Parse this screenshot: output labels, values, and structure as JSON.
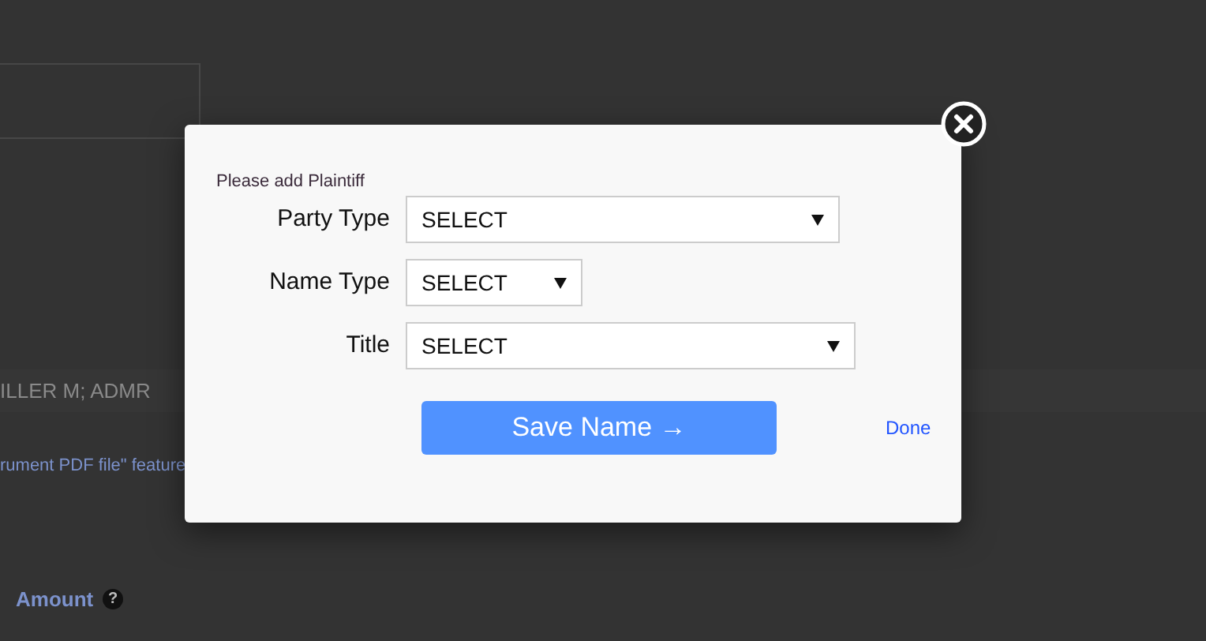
{
  "background": {
    "row_text": "ILLER M; ADMR",
    "link_text": "rument PDF file\" feature",
    "column_header": "Amount",
    "help_icon": "?"
  },
  "dialog": {
    "heading": "Please add Plaintiff",
    "fields": [
      {
        "label": "Party Type",
        "value": "SELECT"
      },
      {
        "label": "Name Type",
        "value": "SELECT"
      },
      {
        "label": "Title",
        "value": "SELECT"
      }
    ],
    "save_button": "Save Name →",
    "done_link": "Done"
  }
}
